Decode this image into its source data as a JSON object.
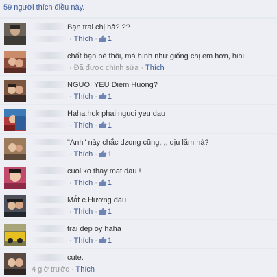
{
  "likes_summary": "59 người thích điều này.",
  "like_label": "Thích",
  "edited_label": "Đã được chỉnh sửa",
  "icons": {
    "like": "thumbs-up-icon"
  },
  "colors": {
    "link": "#3b5998",
    "background": "#edeff4",
    "muted": "#999999"
  },
  "comments": [
    {
      "text": "Bạn trai chị hả? ??",
      "likes": "1"
    },
    {
      "text": "chất bạn bè thôi, mà hình như giống chị em hơn, hihi"
    },
    {
      "text": "NGUOI YEU Diem Huong?",
      "likes": "1"
    },
    {
      "text": "Haha.hok phai nguoi yeu dau",
      "likes": "1"
    },
    {
      "text": "\"Anh\" này chắc dzong cũng,  ,, dịu lắm nà?",
      "likes": "1"
    },
    {
      "text": "cuoi ko thay mat dau !",
      "likes": "1"
    },
    {
      "text": "Mắt c.Hương đâu",
      "likes": "1"
    },
    {
      "text": "trai dep oy haha",
      "likes": "1"
    },
    {
      "text": "cute.",
      "time": "4 giờ trước"
    }
  ]
}
